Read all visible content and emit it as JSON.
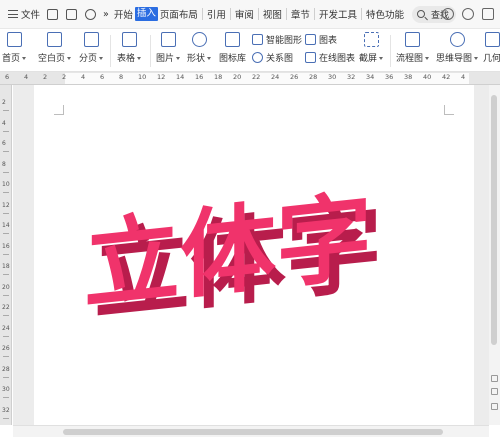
{
  "menubar": {
    "file_label": "文件",
    "tabs": [
      "开始",
      "插入",
      "页面布局",
      "引用",
      "审阅",
      "视图",
      "章节",
      "开发工具",
      "特色功能"
    ],
    "active_tab": "插入",
    "search_label": "查找"
  },
  "ribbon": {
    "cover_page": "首页",
    "blank_page": "空白页",
    "page_break": "分页",
    "table": "表格",
    "picture": "图片",
    "shapes": "形状",
    "icon_lib": "图标库",
    "smart_art": "智能图形",
    "relation_chart": "关系图",
    "chart": "图表",
    "online_chart": "在线图表",
    "screenshot": "截屏",
    "flowchart": "流程图",
    "mindmap": "思维导图",
    "geometry": "几何"
  },
  "ruler": {
    "h_numbers": [
      "6",
      "4",
      "2",
      "2",
      "4",
      "6",
      "8",
      "10",
      "12",
      "14",
      "16",
      "18",
      "20",
      "22",
      "24",
      "26",
      "28",
      "30",
      "32",
      "34",
      "36",
      "38",
      "40",
      "42",
      "4"
    ],
    "v_numbers": [
      "2",
      "4",
      "6",
      "8",
      "10",
      "12",
      "14",
      "16",
      "18",
      "20",
      "22",
      "24",
      "26",
      "28",
      "30",
      "32"
    ]
  },
  "document": {
    "art_text": "立体字",
    "art_color": "#f0336b",
    "art_side_color": "#b81d4c"
  }
}
